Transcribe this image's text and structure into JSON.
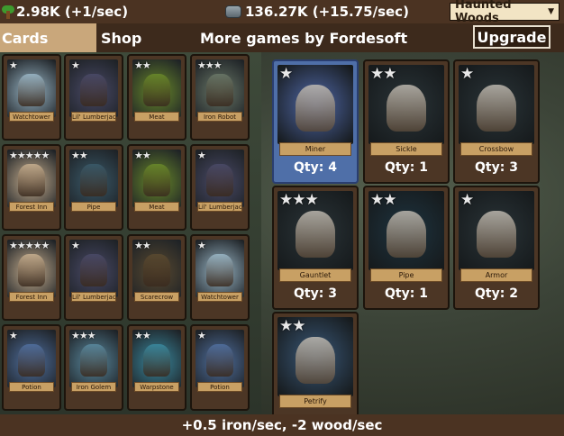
{
  "resources": {
    "wood": "2.98K (+1/sec)",
    "iron": "136.27K (+15.75/sec)"
  },
  "zone": {
    "selected": "Haunted Woods"
  },
  "nav": {
    "cards_tab": "Cards",
    "shop_tab": "Shop",
    "more_games": "More games by Fordesoft",
    "upgrade": "Upgrade"
  },
  "left_cards": [
    {
      "name": "Watchtower",
      "stars": "★",
      "color": "#9bb8c8"
    },
    {
      "name": "Lil' Lumberjack",
      "stars": "★",
      "color": "#4a4a68"
    },
    {
      "name": "Meat",
      "stars": "★★",
      "color": "#6a8a2a"
    },
    {
      "name": "Iron Robot",
      "stars": "★★★",
      "color": "#6a7868"
    },
    {
      "name": "Forest Inn",
      "stars": "★★★★★",
      "color": "#c8b090"
    },
    {
      "name": "Pipe",
      "stars": "★★",
      "color": "#3a5a6a"
    },
    {
      "name": "Meat",
      "stars": "★★",
      "color": "#6a8a2a"
    },
    {
      "name": "Lil' Lumberjack",
      "stars": "★",
      "color": "#4a4a68"
    },
    {
      "name": "Forest Inn",
      "stars": "★★★★★",
      "color": "#c8b090"
    },
    {
      "name": "Lil' Lumberjack",
      "stars": "★",
      "color": "#4a4a68"
    },
    {
      "name": "Scarecrow",
      "stars": "★★",
      "color": "#5a4a30"
    },
    {
      "name": "Watchtower",
      "stars": "★",
      "color": "#9bb8c8"
    },
    {
      "name": "Potion",
      "stars": "★",
      "color": "#5070a0"
    },
    {
      "name": "Iron Golem",
      "stars": "★★★",
      "color": "#5a8aa0"
    },
    {
      "name": "Warpstone",
      "stars": "★★",
      "color": "#3a8aa0"
    },
    {
      "name": "Potion",
      "stars": "★",
      "color": "#5070a0"
    }
  ],
  "deck_cards": [
    {
      "name": "Miner",
      "stars": "★",
      "qty": "Qty: 4",
      "color": "#5068a8"
    },
    {
      "name": "Sickle",
      "stars": "★★",
      "qty": "Qty: 1",
      "color": "#2a3438"
    },
    {
      "name": "Crossbow",
      "stars": "★",
      "qty": "Qty: 3",
      "color": "#2a3438"
    },
    {
      "name": "Gauntlet",
      "stars": "★★★",
      "qty": "Qty: 3",
      "color": "#2a3438"
    },
    {
      "name": "Pipe",
      "stars": "★★",
      "qty": "Qty: 1",
      "color": "#1e3440"
    },
    {
      "name": "Armor",
      "stars": "★",
      "qty": "Qty: 2",
      "color": "#2a3438"
    },
    {
      "name": "Petrify",
      "stars": "★★",
      "qty": "",
      "color": "#3a5878"
    }
  ],
  "status": "+0.5 iron/sec, -2 wood/sec",
  "colors": {
    "bar": "#4b3322",
    "nav": "#3d2a1c",
    "active_tab": "#c9a77b",
    "plate": "#c8a064"
  }
}
